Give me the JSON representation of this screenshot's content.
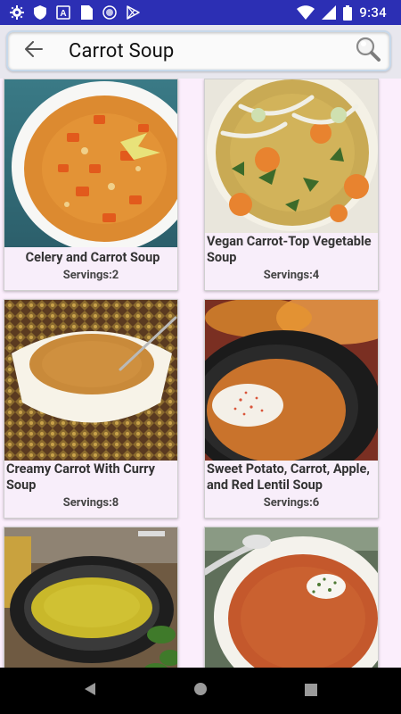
{
  "status_bar": {
    "time": "9:34",
    "left_icons": [
      "gear-icon",
      "shield-icon",
      "a-box-icon",
      "sim-card-icon",
      "circle-icon",
      "play-store-icon"
    ],
    "right_icons": [
      "wifi-icon",
      "signal-icon",
      "battery-icon"
    ]
  },
  "search": {
    "title": "Carrot Soup",
    "back_icon": "arrow-left-icon",
    "search_icon": "magnifier-icon"
  },
  "recipes": [
    {
      "title": "Celery and Carrot Soup",
      "servings": "Servings:2"
    },
    {
      "title": "Vegan Carrot-Top Vegetable Soup",
      "servings": "Servings:4"
    },
    {
      "title": "Creamy Carrot With Curry Soup",
      "servings": "Servings:8"
    },
    {
      "title": "Sweet Potato, Carrot, Apple, and Red Lentil Soup",
      "servings": "Servings:6"
    },
    {
      "title": "",
      "servings": ""
    },
    {
      "title": "",
      "servings": ""
    }
  ],
  "nav": {
    "back_icon": "nav-back-triangle-icon",
    "home_icon": "nav-home-circle-icon",
    "recents_icon": "nav-recents-square-icon"
  },
  "colors": {
    "status_bar": "#2c2fb4",
    "background": "#fbeefc",
    "card": "#f8eefa"
  }
}
